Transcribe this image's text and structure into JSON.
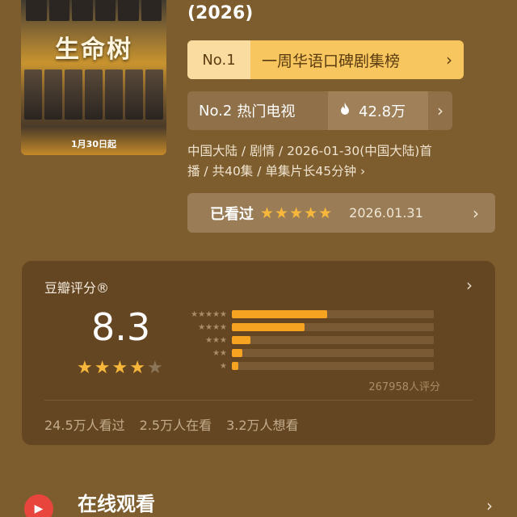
{
  "poster": {
    "title_art": "生命树",
    "release_text": "1月30日起"
  },
  "show": {
    "year": "(2026)"
  },
  "rankings": {
    "first": {
      "rank": "No.1",
      "label": "一周华语口碑剧集榜"
    },
    "second": {
      "rank": "No.2",
      "label": "热门电视",
      "heat": "42.8万"
    }
  },
  "meta": {
    "line1": "中国大陆 / 剧情 / 2026-01-30(中国大陆)首",
    "line2": "播 / 共40集 / 单集片长45分钟 ›"
  },
  "my_rating": {
    "label": "已看过",
    "stars": "★★★★★",
    "date": "2026.01.31"
  },
  "douban": {
    "title": "豆瓣评分®",
    "score": "8.3",
    "stars_filled": 4,
    "stars_total": 5,
    "distribution": [
      {
        "stars": "★★★★★",
        "percent": 47
      },
      {
        "stars": "★★★★",
        "percent": 36
      },
      {
        "stars": "★★★",
        "percent": 9
      },
      {
        "stars": "★★",
        "percent": 5
      },
      {
        "stars": "★",
        "percent": 3
      }
    ],
    "rating_count": "267958人评分",
    "watched": "24.5万人看过",
    "watching": "2.5万人在看",
    "want": "3.2万人想看"
  },
  "online": {
    "title": "在线观看"
  },
  "colors": {
    "background": "#7d5c2d",
    "card": "#654622",
    "accent_gold": "#f8c65e",
    "star": "#f7b73a",
    "bar_fill": "#f7a322",
    "play_red": "#e8453c"
  }
}
